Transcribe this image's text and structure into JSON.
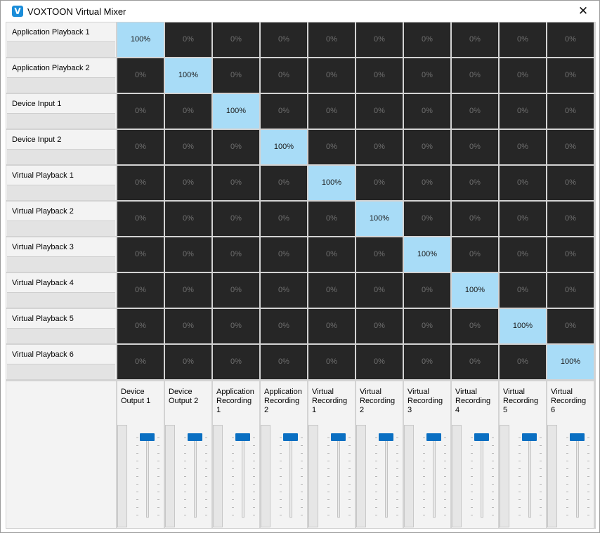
{
  "window": {
    "title": "VOXTOON Virtual Mixer",
    "icon_letter": "V",
    "close_glyph": "✕"
  },
  "inputs": [
    "Application Playback 1",
    "Application Playback 2",
    "Device Input 1",
    "Device Input 2",
    "Virtual Playback 1",
    "Virtual Playback 2",
    "Virtual Playback 3",
    "Virtual Playback 4",
    "Virtual Playback 5",
    "Virtual Playback 6"
  ],
  "outputs": [
    "Device\nOutput 1",
    "Device\nOutput 2",
    "Application\nRecording\n1",
    "Application\nRecording\n2",
    "Virtual\nRecording\n1",
    "Virtual\nRecording\n2",
    "Virtual\nRecording\n3",
    "Virtual\nRecording\n4",
    "Virtual\nRecording\n5",
    "Virtual\nRecording\n6"
  ],
  "matrix": [
    [
      "100%",
      "0%",
      "0%",
      "0%",
      "0%",
      "0%",
      "0%",
      "0%",
      "0%",
      "0%"
    ],
    [
      "0%",
      "100%",
      "0%",
      "0%",
      "0%",
      "0%",
      "0%",
      "0%",
      "0%",
      "0%"
    ],
    [
      "0%",
      "0%",
      "100%",
      "0%",
      "0%",
      "0%",
      "0%",
      "0%",
      "0%",
      "0%"
    ],
    [
      "0%",
      "0%",
      "0%",
      "100%",
      "0%",
      "0%",
      "0%",
      "0%",
      "0%",
      "0%"
    ],
    [
      "0%",
      "0%",
      "0%",
      "0%",
      "100%",
      "0%",
      "0%",
      "0%",
      "0%",
      "0%"
    ],
    [
      "0%",
      "0%",
      "0%",
      "0%",
      "0%",
      "100%",
      "0%",
      "0%",
      "0%",
      "0%"
    ],
    [
      "0%",
      "0%",
      "0%",
      "0%",
      "0%",
      "0%",
      "100%",
      "0%",
      "0%",
      "0%"
    ],
    [
      "0%",
      "0%",
      "0%",
      "0%",
      "0%",
      "0%",
      "0%",
      "100%",
      "0%",
      "0%"
    ],
    [
      "0%",
      "0%",
      "0%",
      "0%",
      "0%",
      "0%",
      "0%",
      "0%",
      "100%",
      "0%"
    ],
    [
      "0%",
      "0%",
      "0%",
      "0%",
      "0%",
      "0%",
      "0%",
      "0%",
      "0%",
      "100%"
    ]
  ],
  "output_fader_levels": [
    1,
    1,
    1,
    1,
    1,
    1,
    1,
    1,
    1,
    1
  ],
  "colors": {
    "cell_active": "#a8dcf7",
    "cell_inactive": "#262626",
    "fader_thumb": "#0a6fc2",
    "app_icon": "#1b8dd9"
  }
}
